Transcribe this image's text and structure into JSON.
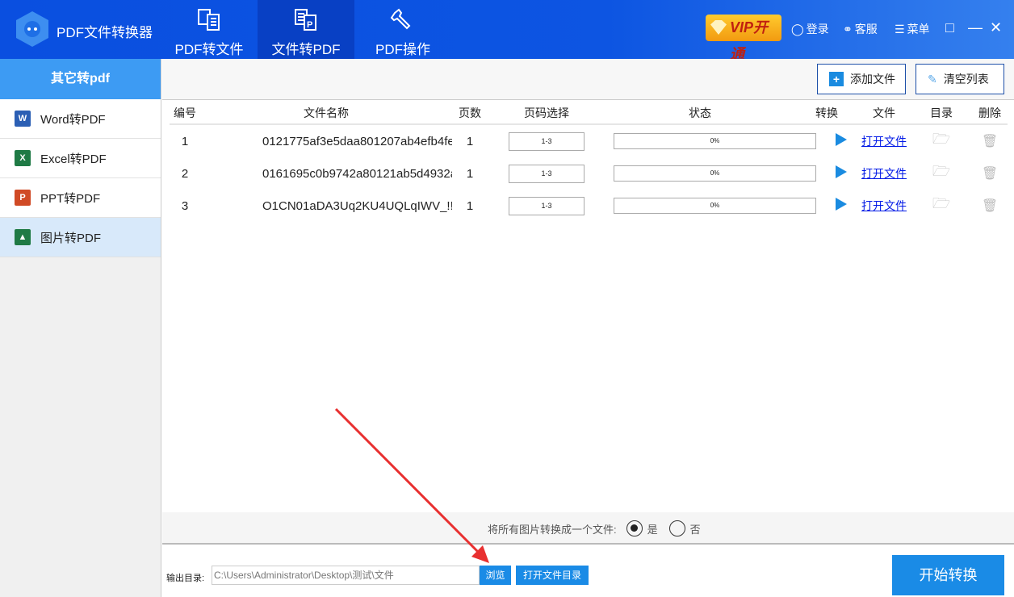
{
  "app": {
    "title": "PDF文件转换器"
  },
  "nav": {
    "tabs": [
      {
        "label": "PDF转文件"
      },
      {
        "label": "文件转PDF"
      },
      {
        "label": "PDF操作"
      }
    ],
    "active": 1
  },
  "header": {
    "vip": "VIP开通",
    "login": "登录",
    "service": "客服",
    "menu": "菜单"
  },
  "sidebar": {
    "title": "其它转pdf",
    "items": [
      {
        "label": "Word转PDF",
        "icon": "W"
      },
      {
        "label": "Excel转PDF",
        "icon": "X"
      },
      {
        "label": "PPT转PDF",
        "icon": "P"
      },
      {
        "label": "图片转PDF",
        "icon": "▲"
      }
    ],
    "active": 3
  },
  "toolbar": {
    "add": "添加文件",
    "clear": "清空列表"
  },
  "table": {
    "headers": [
      "编号",
      "文件名称",
      "页数",
      "页码选择",
      "状态",
      "转换",
      "文件",
      "目录",
      "删除"
    ],
    "rows": [
      {
        "no": "1",
        "name": "0121775af3e5daa801207ab4efb4fe",
        "pages": "1",
        "range": "1-3",
        "status": "0%",
        "open": "打开文件"
      },
      {
        "no": "2",
        "name": "0161695c0b9742a80121ab5d4932a",
        "pages": "1",
        "range": "1-3",
        "status": "0%",
        "open": "打开文件"
      },
      {
        "no": "3",
        "name": "O1CN01aDA3Uq2KU4UQLqIWV_!!(",
        "pages": "1",
        "range": "1-3",
        "status": "0%",
        "open": "打开文件"
      }
    ]
  },
  "merge": {
    "label": "将所有图片转换成一个文件:",
    "yes": "是",
    "no": "否",
    "selected": "是"
  },
  "output": {
    "label": "输出目录:",
    "path": "C:\\Users\\Administrator\\Desktop\\测试\\文件",
    "browse": "浏览",
    "open_dir": "打开文件目录"
  },
  "start": "开始转换",
  "colors": {
    "header": "#0d55e2",
    "accent": "#1a8be6",
    "sidebar_head": "#3d9bf3",
    "annotation": "#e83030"
  }
}
